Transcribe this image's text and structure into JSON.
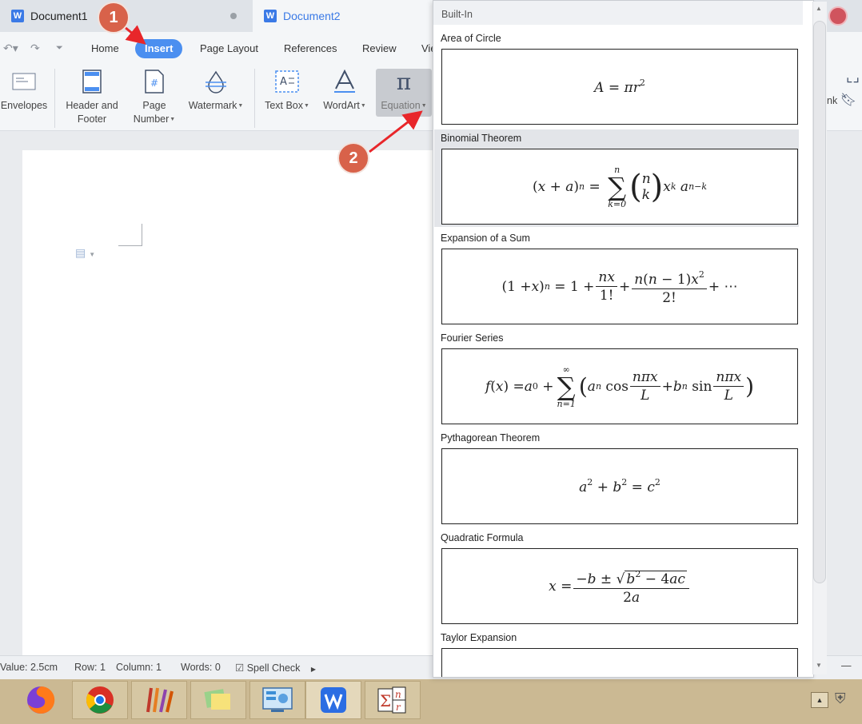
{
  "tabs": [
    {
      "label": "Document1"
    },
    {
      "label": "Document2"
    }
  ],
  "menu": {
    "home": "Home",
    "insert": "Insert",
    "page_layout": "Page Layout",
    "references": "References",
    "review": "Review",
    "view_partial": "Vie"
  },
  "ribbon": {
    "envelopes": "Envelopes",
    "header_footer_1": "Header and",
    "header_footer_2": "Footer",
    "page_number_1": "Page",
    "page_number_2": "Number",
    "watermark": "Watermark",
    "text_box": "Text Box",
    "wordart": "WordArt",
    "equation": "Equation",
    "right_partial": "nk"
  },
  "status": {
    "value": "Value: 2.5cm",
    "row": "Row: 1",
    "column": "Column: 1",
    "words": "Words: 0",
    "spell_check": "Spell Check"
  },
  "gallery": {
    "header": "Built-In",
    "items": [
      {
        "title": "Area of Circle"
      },
      {
        "title": "Binomial Theorem"
      },
      {
        "title": "Expansion of a Sum"
      },
      {
        "title": "Fourier Series"
      },
      {
        "title": "Pythagorean Theorem"
      },
      {
        "title": "Quadratic Formula"
      },
      {
        "title": "Taylor Expansion"
      }
    ]
  },
  "annotations": {
    "step1": "1",
    "step2": "2",
    "color": "#d8624a",
    "arrow_color": "#e8262a"
  },
  "colors": {
    "accent": "#4b8ff0",
    "wps_blue": "#3b7ae6"
  }
}
